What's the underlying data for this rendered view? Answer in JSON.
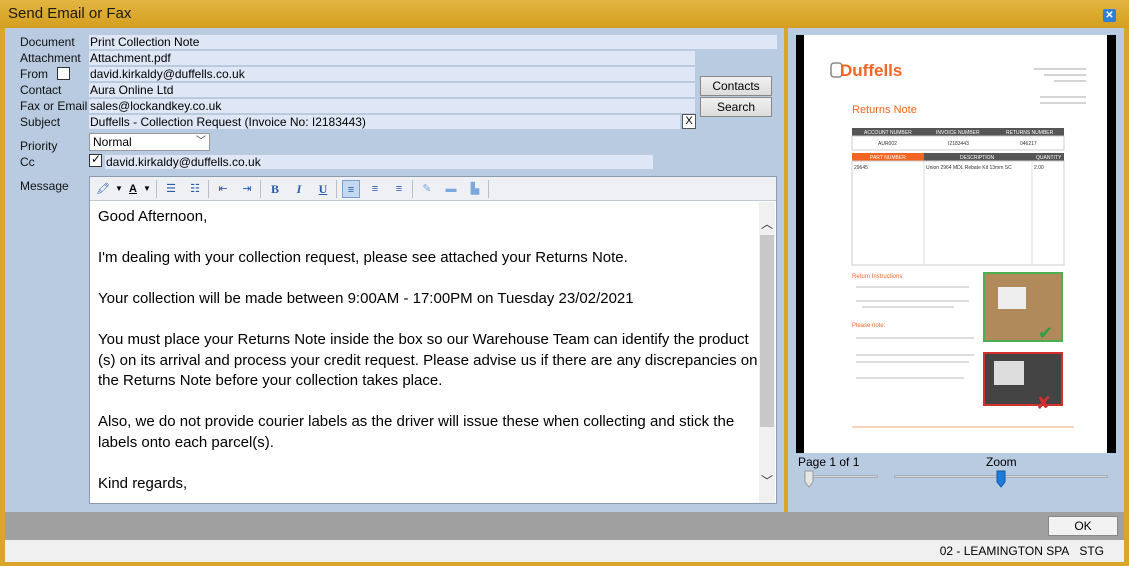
{
  "window": {
    "title": "Send Email or Fax",
    "close_icon": "close-icon"
  },
  "labels": {
    "document": "Document",
    "attachment": "Attachment",
    "from": "From",
    "contact": "Contact",
    "fax_or_email": "Fax or Email",
    "subject": "Subject",
    "priority": "Priority",
    "cc": "Cc",
    "message": "Message"
  },
  "fields": {
    "document": "Print Collection Note",
    "attachment": "Attachment.pdf",
    "from": "david.kirkaldy@duffells.co.uk",
    "contact": "Aura Online Ltd",
    "fax_or_email": "sales@lockandkey.co.uk",
    "subject": "Duffells - Collection Request (Invoice No: I2183443)",
    "priority": "Normal",
    "cc": "david.kirkaldy@duffells.co.uk"
  },
  "checkboxes": {
    "from_checked": false,
    "cc_checked": true
  },
  "buttons": {
    "contacts": "Contacts",
    "search": "Search",
    "clear_subject": "X",
    "ok": "OK"
  },
  "message": {
    "paragraphs": [
      "Good Afternoon,",
      "I'm dealing with your collection request, please see attached your Returns Note.",
      "Your collection will be made between 9:00AM - 17:00PM on Tuesday 23/02/2021",
      "You must place your Returns Note inside the box so our Warehouse Team can identify the product (s) on its arrival and process your credit request. Please advise us if there are any discrepancies on the Returns Note before your collection takes place.",
      "Also, we do not provide courier labels as the driver will issue these when collecting and stick the labels onto each parcel(s).",
      "Kind regards,"
    ]
  },
  "preview": {
    "page_label": "Page 1 of 1",
    "zoom_label": "Zoom",
    "page_slider_fraction": 0.0,
    "zoom_slider_fraction": 0.5,
    "document": {
      "logo": "Duffells",
      "heading": "Returns Note",
      "table1_headers": [
        "ACCOUNT NUMBER",
        "INVOICE NUMBER",
        "RETURNS NUMBER"
      ],
      "table1_values": [
        "AUR002",
        "I2183443",
        "046217"
      ],
      "table2_headers": [
        "PART NUMBER",
        "DESCRIPTION",
        "QUANTITY"
      ],
      "table2_values": [
        "29645",
        "Union 2964 MDL Rebate Kit 13mm SC",
        "2.00"
      ],
      "return_instructions": "Return Instructions",
      "please_note": "Please note:"
    }
  },
  "status": {
    "branch": "02 - LEAMINGTON SPA",
    "env": "STG"
  },
  "colors": {
    "accent_gold": "#d8a62a",
    "panel_blue": "#b8cbe0",
    "brand_orange": "#f26522"
  }
}
